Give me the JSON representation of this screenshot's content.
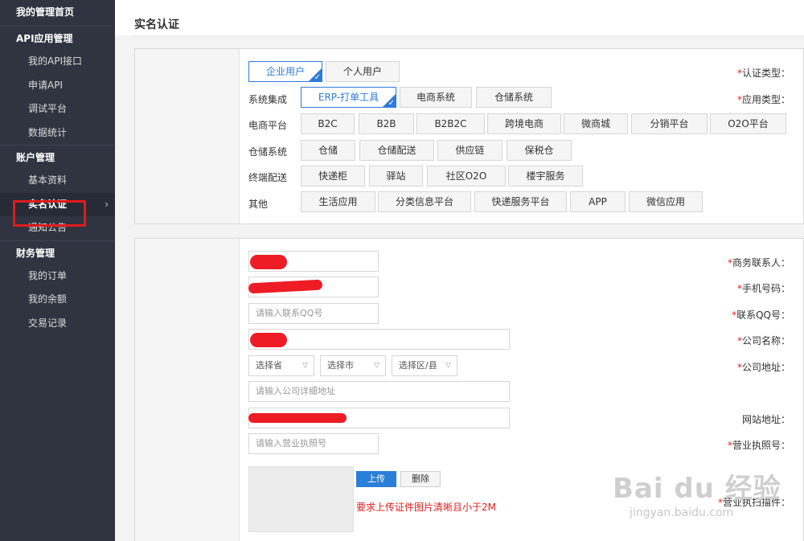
{
  "sidebar": {
    "home": "我的管理首页",
    "groups": [
      {
        "title": "API应用管理",
        "items": [
          "我的API接口",
          "申请API",
          "调试平台",
          "数据统计"
        ]
      },
      {
        "title": "账户管理",
        "items": [
          "基本资料",
          "实名认证",
          "通知公告"
        ]
      },
      {
        "title": "财务管理",
        "items": [
          "我的订单",
          "我的余额",
          "交易记录"
        ]
      }
    ],
    "active_chevron": "›"
  },
  "page": {
    "title": "实名认证"
  },
  "cert_type": {
    "label": "认证类型：",
    "required": "*",
    "options": [
      "企业用户",
      "个人用户"
    ],
    "selected": "企业用户"
  },
  "app_type": {
    "label": "应用类型：",
    "required": "*",
    "rows": [
      {
        "label": "系统集成",
        "options": [
          "ERP-打单工具",
          "电商系统",
          "仓储系统"
        ]
      },
      {
        "label": "电商平台",
        "options": [
          "B2C",
          "B2B",
          "B2B2C",
          "跨境电商",
          "微商城",
          "分销平台",
          "O2O平台"
        ]
      },
      {
        "label": "仓储系统",
        "options": [
          "仓储",
          "仓储配送",
          "供应链",
          "保税仓"
        ]
      },
      {
        "label": "终端配送",
        "options": [
          "快递柜",
          "驿站",
          "社区O2O",
          "楼宇服务"
        ]
      },
      {
        "label": "其他",
        "options": [
          "生活应用",
          "分类信息平台",
          "快递服务平台",
          "APP",
          "微信应用"
        ]
      }
    ],
    "selected": "ERP-打单工具"
  },
  "form": {
    "contact": {
      "label": "商务联系人：",
      "required": "*"
    },
    "phone": {
      "label": "手机号码：",
      "required": "*"
    },
    "qq": {
      "label": "联系QQ号：",
      "required": "*",
      "placeholder": "请输入联系QQ号"
    },
    "company": {
      "label": "公司名称：",
      "required": "*"
    },
    "address": {
      "label": "公司地址：",
      "required": "*",
      "province": "选择省",
      "city": "选择市",
      "district": "选择区/县",
      "detail_placeholder": "请输入公司详细地址"
    },
    "website": {
      "label": "网站地址："
    },
    "license_no": {
      "label": "营业执照号：",
      "required": "*",
      "placeholder": "请输入营业执照号"
    },
    "license_scan": {
      "label": "营业执扫描件：",
      "required": "*",
      "upload": "上传",
      "delete": "删除",
      "note": "要求上传证件图片清晰且小于2M"
    }
  },
  "watermark": {
    "brand": "Bai du 经验",
    "url": "jingyan.baidu.com"
  },
  "colors": {
    "accent": "#2f7bd8",
    "required": "#e02020",
    "sidebar": "#2f3440",
    "highlight": "#e01b1b"
  }
}
